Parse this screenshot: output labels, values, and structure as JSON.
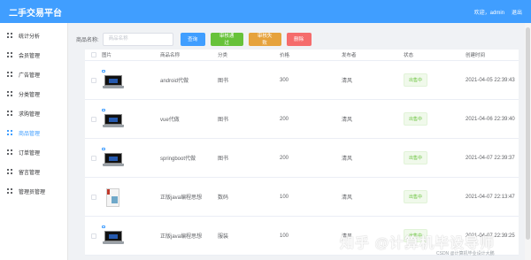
{
  "header": {
    "title": "二手交易平台",
    "welcome": "欢迎，admin",
    "logout": "退出"
  },
  "sidebar": {
    "items": [
      {
        "label": "统计分析",
        "active": false
      },
      {
        "label": "会员管理",
        "active": false
      },
      {
        "label": "广告管理",
        "active": false
      },
      {
        "label": "分类管理",
        "active": false
      },
      {
        "label": "求购管理",
        "active": false
      },
      {
        "label": "商品管理",
        "active": true
      },
      {
        "label": "订单管理",
        "active": false
      },
      {
        "label": "留言管理",
        "active": false
      },
      {
        "label": "管理员管理",
        "active": false
      }
    ]
  },
  "search": {
    "label": "商品名称:",
    "placeholder": "商品名称",
    "search_btn": "查询",
    "approve_btn": "审核通过",
    "reject_btn": "审核失败",
    "delete_btn": "删除"
  },
  "table": {
    "headers": {
      "image": "图片",
      "name": "商品名称",
      "category": "分类",
      "price": "价格",
      "publisher": "发布者",
      "status": "状态",
      "created": "创建时间"
    },
    "rows": [
      {
        "name": "android代做",
        "category": "图书",
        "price": "300",
        "publisher": "清风",
        "status": "出售中",
        "created": "2021-04-05 22:39:43",
        "thumb": "laptop"
      },
      {
        "name": "vue代做",
        "category": "图书",
        "price": "200",
        "publisher": "清风",
        "status": "出售中",
        "created": "2021-04-06 22:39:40",
        "thumb": "laptop"
      },
      {
        "name": "springboot代做",
        "category": "图书",
        "price": "200",
        "publisher": "清风",
        "status": "出售中",
        "created": "2021-04-07 22:39:37",
        "thumb": "laptop"
      },
      {
        "name": "正版java编程思想",
        "category": "数码",
        "price": "100",
        "publisher": "清风",
        "status": "出售中",
        "created": "2021-04-07 22:13:47",
        "thumb": "book"
      },
      {
        "name": "正版java编程思想",
        "category": "服装",
        "price": "100",
        "publisher": "清风",
        "status": "出售中",
        "created": "2021-04-07 22:39:25",
        "thumb": "laptop"
      }
    ]
  },
  "watermark": {
    "text": "知乎 @计算机毕设导师",
    "credit": "CSDN @计算机毕业设计大鹏"
  },
  "colors": {
    "primary": "#409eff",
    "success": "#67c23a",
    "warning": "#e6a23c",
    "danger": "#f56c6c"
  }
}
